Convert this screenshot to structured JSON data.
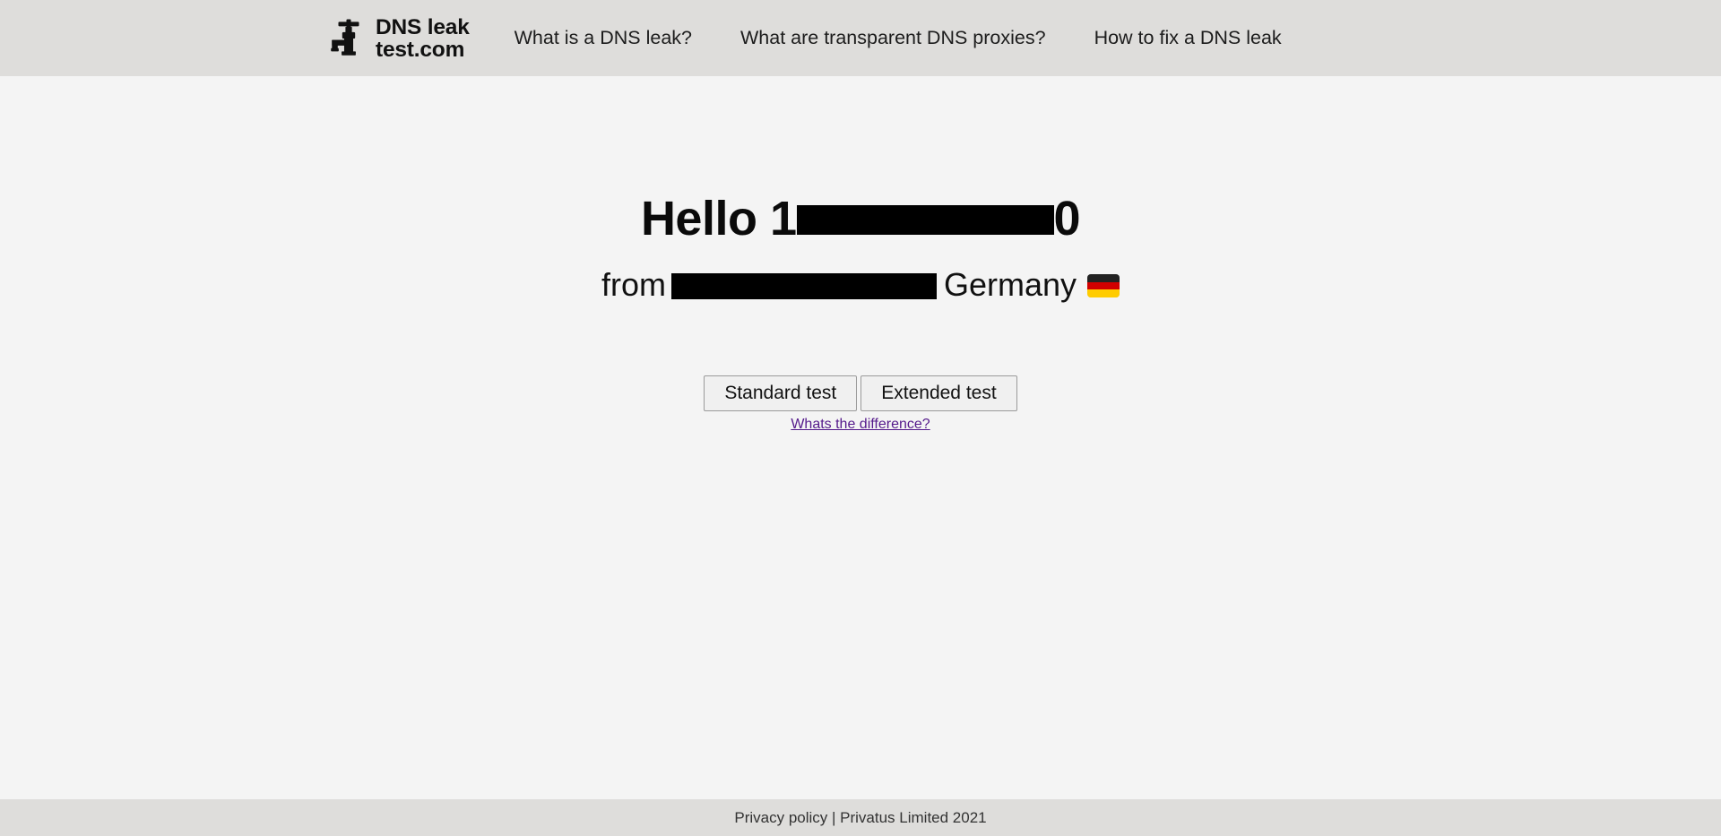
{
  "colors": {
    "header_bg": "#dedddb",
    "page_bg": "#f4f4f4",
    "footer_bg": "#dedddb",
    "redaction": "#000000",
    "link_visited": "#551a8b",
    "button_bg": "#f0f0f0",
    "button_border": "#9a9a9a",
    "flag_black": "#222222",
    "flag_red": "#d00000",
    "flag_gold": "#ffcc00"
  },
  "header": {
    "logo": {
      "icon": "faucet-tap-icon",
      "line1_strong": "DNS",
      "line1_light": " leak",
      "line2": "test.com",
      "alt": "DNS leak test.com"
    },
    "nav": [
      {
        "label": "What is a DNS leak?",
        "name": "nav-what-is-dns-leak"
      },
      {
        "label": "What are transparent DNS proxies?",
        "name": "nav-transparent-dns-proxies"
      },
      {
        "label": "How to fix a DNS leak",
        "name": "nav-how-to-fix-dns-leak"
      }
    ]
  },
  "main": {
    "greeting": {
      "prefix": "Hello 1",
      "redacted_ip": "",
      "suffix": "0"
    },
    "origin": {
      "prefix": "from",
      "redacted_isp": "",
      "country": "Germany",
      "flag": "german-flag-icon"
    },
    "buttons": {
      "standard": "Standard test",
      "extended": "Extended test"
    },
    "difference_link": "Whats the difference?"
  },
  "footer": {
    "text": "Privacy policy | Privatus Limited 2021"
  }
}
